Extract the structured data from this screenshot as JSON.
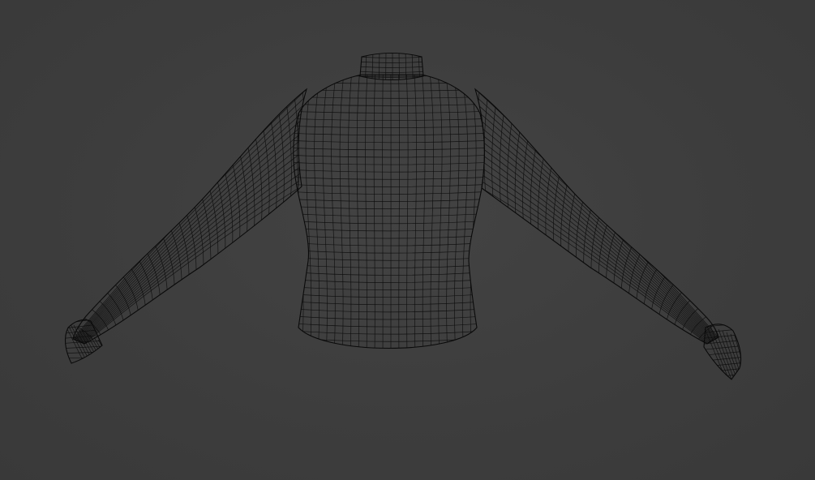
{
  "viewport": {
    "background_color": "#3d3d3d",
    "wire_color": "#0d0d0d",
    "object": "sweater-mesh",
    "display_mode": "wireframe"
  }
}
